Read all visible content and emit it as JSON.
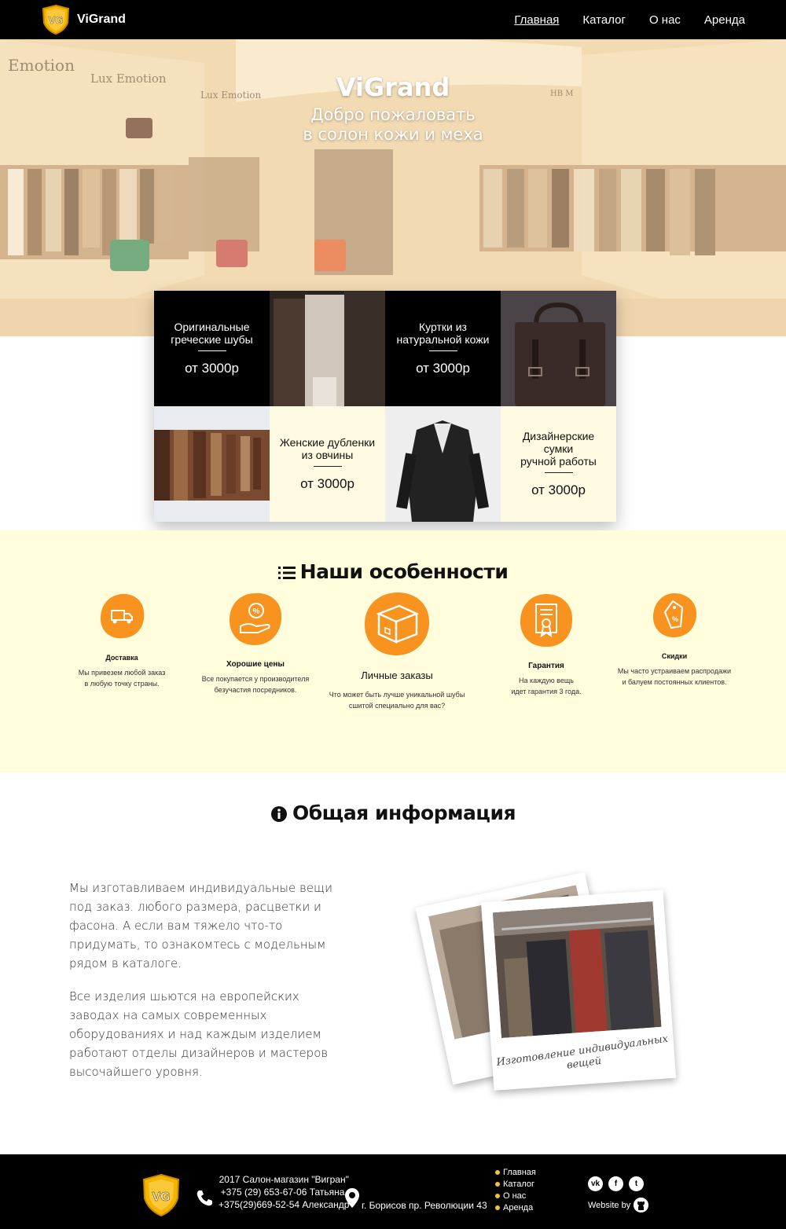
{
  "brand": {
    "name": "ViGrand",
    "badge": "VG"
  },
  "nav": [
    {
      "label": "Главная",
      "active": true
    },
    {
      "label": "Каталог",
      "active": false
    },
    {
      "label": "О нас",
      "active": false
    },
    {
      "label": "Аренда",
      "active": false
    }
  ],
  "hero": {
    "title": "ViGrand",
    "subtitle_line1": "Добро пожаловать",
    "subtitle_line2": "в солон кожи и меха",
    "signs": [
      "Emotion",
      "Lux Emotion",
      "Lux Emotion",
      "HB M"
    ]
  },
  "products": [
    {
      "name_line1": "Оригинальные",
      "name_line2": "греческие шубы",
      "price": "от 3000р"
    },
    {
      "name_line1": "Куртки из",
      "name_line2": "натуральной кожи",
      "price": "от 3000р"
    },
    {
      "name_line1": "Женские дубленки",
      "name_line2": "из овчины",
      "price": "от 3000р"
    },
    {
      "name_line1": "Дизайнерские сумки",
      "name_line2": "ручной работы",
      "price": "от 3000р"
    }
  ],
  "features": {
    "title": "Наши особенности",
    "items": [
      {
        "name": "Доставка",
        "desc1": "Мы привезем любой заказ",
        "desc2": "в любую точку страны.",
        "icon": "truck-icon"
      },
      {
        "name": "Хорошие цены",
        "desc1": "Все покупается у производителя",
        "desc2": "безучастия посредников.",
        "icon": "percent-hand-icon"
      },
      {
        "name": "Личные заказы",
        "desc1": "Что может быть лучше уникальной шубы",
        "desc2": "сшитой специально для вас?",
        "icon": "box-icon"
      },
      {
        "name": "Гарантия",
        "desc1": "На каждую вещь",
        "desc2": "идет гарантия 3 года.",
        "icon": "certificate-icon"
      },
      {
        "name": "Скидки",
        "desc1": "Мы часто устраиваем распродажи",
        "desc2": "и балуем постоянных клиентов.",
        "icon": "tag-icon"
      }
    ]
  },
  "info": {
    "title": "Общая информация",
    "p1": "Мы изготавливаем индивидуальные вещи под заказ. любого размера, расцветки и фасона. А если вам тяжело что-то придумать, то ознакомтесь с модельным рядом в каталоге.",
    "p2": "Все изделия шьются на европейских заводах на самых современных оборудованиях и над каждым изделием работают отделы дизайнеров и мастеров высочайшего уровня.",
    "photo_caption": "Изготовление индивидуальных вещей"
  },
  "footer": {
    "line1": "2017 Салон-магазин \"Вигран\"",
    "line2": "+375 (29) 653-67-06 Татьяна,",
    "line3": "+375(29)669-52-54 Александр",
    "address": "г. Борисов пр. Революции 43",
    "links": [
      "Главная",
      "Каталог",
      "О нас",
      "Аренда"
    ],
    "social": [
      "vk-icon",
      "facebook-icon",
      "twitter-icon"
    ],
    "website_by": "Website by"
  },
  "colors": {
    "accent": "#f7931e",
    "header_bg": "#000000",
    "features_bg": "#fffddc",
    "tile_light": "#fffbe2"
  }
}
